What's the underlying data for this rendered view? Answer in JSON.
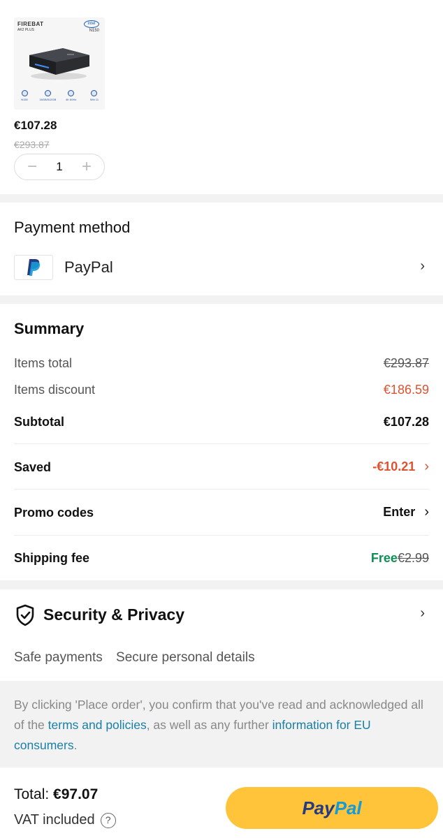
{
  "product": {
    "brand": "FIREBAT",
    "model": "AK2 PLUS",
    "intel_badge": "intel",
    "cpu": "N150",
    "specs": [
      "N150",
      "16GB/512GB",
      "4K 60Hz",
      "Win 11"
    ],
    "price": "€107.28",
    "original_price": "€293.87",
    "quantity": "1",
    "minus": "−",
    "plus": "+"
  },
  "payment": {
    "title": "Payment method",
    "method": "PayPal",
    "chevron": "›"
  },
  "summary": {
    "title": "Summary",
    "items_total_label": "Items total",
    "items_total_value": "€293.87",
    "items_discount_label": "Items discount",
    "items_discount_value": "€186.59",
    "subtotal_label": "Subtotal",
    "subtotal_value": "€107.28",
    "saved_label": "Saved",
    "saved_value": "-€10.21",
    "promo_label": "Promo codes",
    "promo_value": "Enter",
    "shipping_label": "Shipping fee",
    "shipping_free": "Free",
    "shipping_original": "€2.99",
    "chevron": "›"
  },
  "security": {
    "title": "Security & Privacy",
    "safe_payments": "Safe payments",
    "secure_details": "Secure personal details",
    "chevron": "›"
  },
  "notice": {
    "text_1": "By clicking 'Place order', you confirm that you've read and acknowledged all of the ",
    "link_1": "terms and policies",
    "text_2": ", as well as any further ",
    "link_2": "information for EU consumers",
    "text_3": "."
  },
  "footer": {
    "total_label": "Total:",
    "total_value": "€97.07",
    "vat": "VAT included",
    "help": "?",
    "paypal_pay": "Pay",
    "paypal_pal": "Pal"
  },
  "colors": {
    "accent_red": "#e0512f",
    "free_green": "#0f8f55",
    "link_blue": "#1a7fa6",
    "paypal_yellow": "#ffc439"
  }
}
